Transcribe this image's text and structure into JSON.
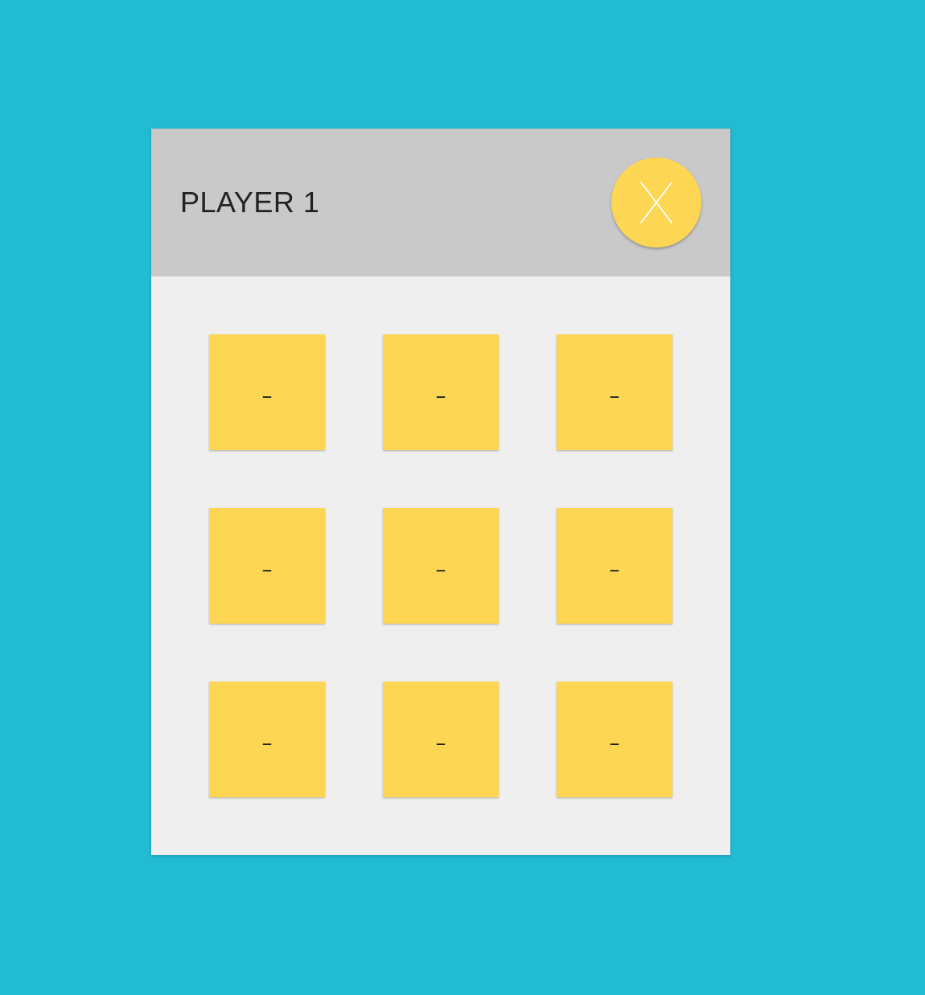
{
  "header": {
    "player_label": "PLAYER 1",
    "current_mark": "X"
  },
  "board": {
    "cells": [
      {
        "row": 1,
        "col": 1,
        "value": "–"
      },
      {
        "row": 1,
        "col": 2,
        "value": "–"
      },
      {
        "row": 1,
        "col": 3,
        "value": "–"
      },
      {
        "row": 2,
        "col": 1,
        "value": "–"
      },
      {
        "row": 2,
        "col": 2,
        "value": "–"
      },
      {
        "row": 2,
        "col": 3,
        "value": "–"
      },
      {
        "row": 3,
        "col": 1,
        "value": "–"
      },
      {
        "row": 3,
        "col": 2,
        "value": "–"
      },
      {
        "row": 3,
        "col": 3,
        "value": "–"
      }
    ]
  },
  "colors": {
    "background": "#21bbd4",
    "card": "#efefef",
    "header": "#c9c9c9",
    "accent": "#fdd653",
    "text": "#222222"
  },
  "icons": {
    "current_mark_icon": "x-icon"
  }
}
